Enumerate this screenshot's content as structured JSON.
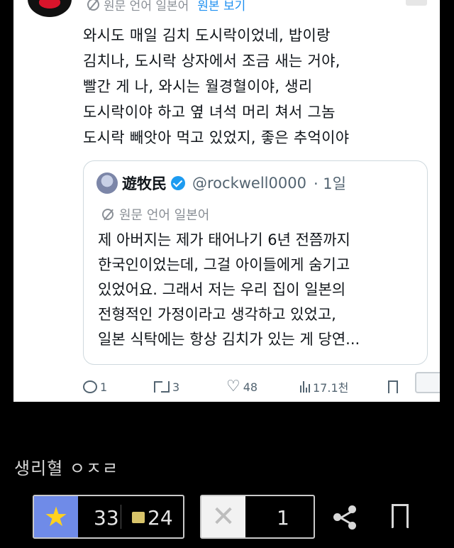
{
  "tweet": {
    "translation_label": "원문 언어 일본어",
    "show_original_label": "원본 보기",
    "text": "와시도 매일 김치 도시락이었네, 밥이랑\n김치나, 도시락 상자에서 조금 새는 거야,\n빨간 게 나, 와시는 월경혈이야, 생리\n도시락이야 하고 옆 녀석 머리 쳐서 그놈\n도시락 빼앗아 먹고 있었지, 좋은 추억이야"
  },
  "quote": {
    "name": "遊牧民",
    "handle": "@rockwell0000",
    "time": "· 1일",
    "translation_label": "원문 언어 일본어",
    "text": "제 아버지는 제가 태어나기 6년 전쯤까지\n한국인이었는데, 그걸 아이들에게 숨기고\n있었어요. 그래서 저는 우리 집이 일본의\n전형적인 가정이라고 생각하고 있었고,\n일본 식탁에는 항상 김치가 있는 게 당연..."
  },
  "actions": {
    "replies": "1",
    "retweets": "3",
    "likes": "48",
    "views": "17.1천"
  },
  "caption": "생리혈 ㅇㅈㄹ",
  "bottom_bar": {
    "upvotes": "33",
    "comments": "24",
    "downvotes": "1"
  },
  "colors": {
    "accent_blue": "#1d8ff0",
    "star_bg": "#6f8be8",
    "star": "#ffd21f"
  }
}
